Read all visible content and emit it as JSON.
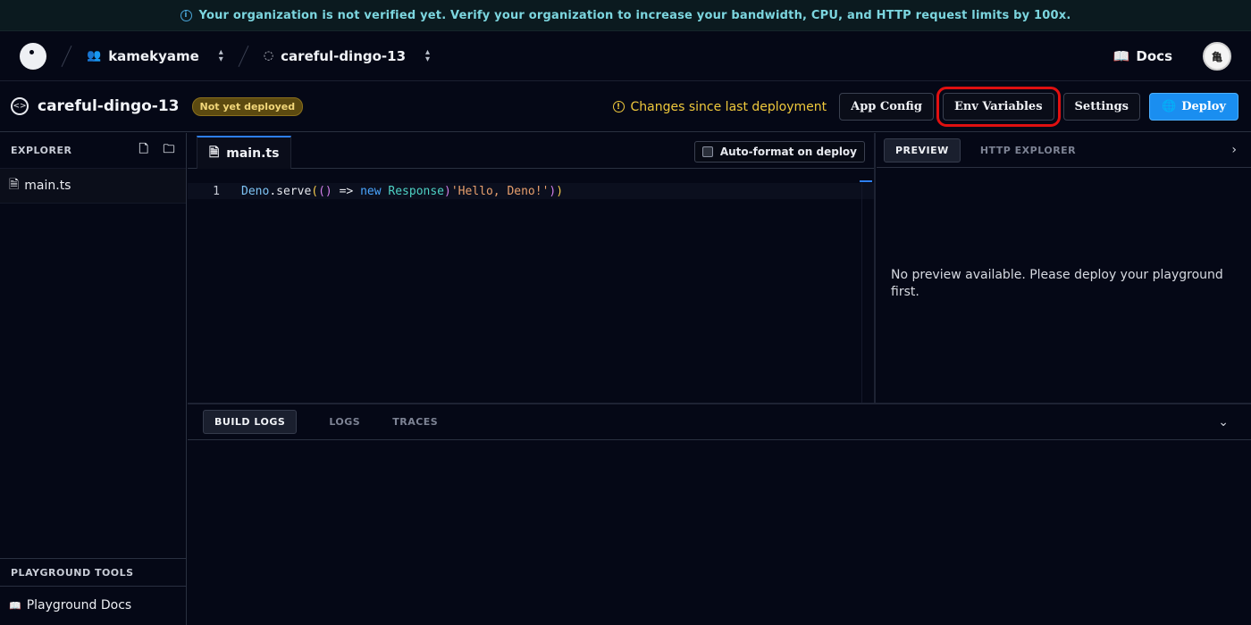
{
  "banner": {
    "text": "Your organization is not verified yet. Verify your organization to increase your bandwidth, CPU, and HTTP request limits by 100x."
  },
  "topnav": {
    "org": "kamekyame",
    "project": "careful-dingo-13",
    "docs_label": "Docs",
    "avatar_text": "亀"
  },
  "projbar": {
    "title": "careful-dingo-13",
    "status_badge": "Not yet deployed",
    "changes_text": "Changes since last deployment",
    "buttons": {
      "app_config": "App Config",
      "env_variables": "Env Variables",
      "settings": "Settings",
      "deploy": "Deploy"
    }
  },
  "explorer": {
    "title": "EXPLORER",
    "files": [
      "main.ts"
    ],
    "tools_title": "PLAYGROUND TOOLS",
    "tools_item": "Playground Docs"
  },
  "editor": {
    "tab": "main.ts",
    "autoformat_label": "Auto-format on deploy",
    "line_number": "1",
    "code": {
      "deno": "Deno",
      "dot": ".",
      "serve": "serve",
      "p1": "(",
      "p2": "()",
      "arrow": " => ",
      "new": "new",
      "sp": " ",
      "cls": "Response",
      "str": "'Hello, Deno!'",
      "p3": ")",
      "p4": ")"
    }
  },
  "preview": {
    "tabs": [
      "PREVIEW",
      "HTTP EXPLORER"
    ],
    "message": "No preview available. Please deploy your playground first."
  },
  "logs": {
    "tabs": [
      "BUILD LOGS",
      "LOGS",
      "TRACES"
    ]
  },
  "icons": {
    "info": "info-icon",
    "warning": "warning-icon",
    "deploy": "globe-icon"
  }
}
